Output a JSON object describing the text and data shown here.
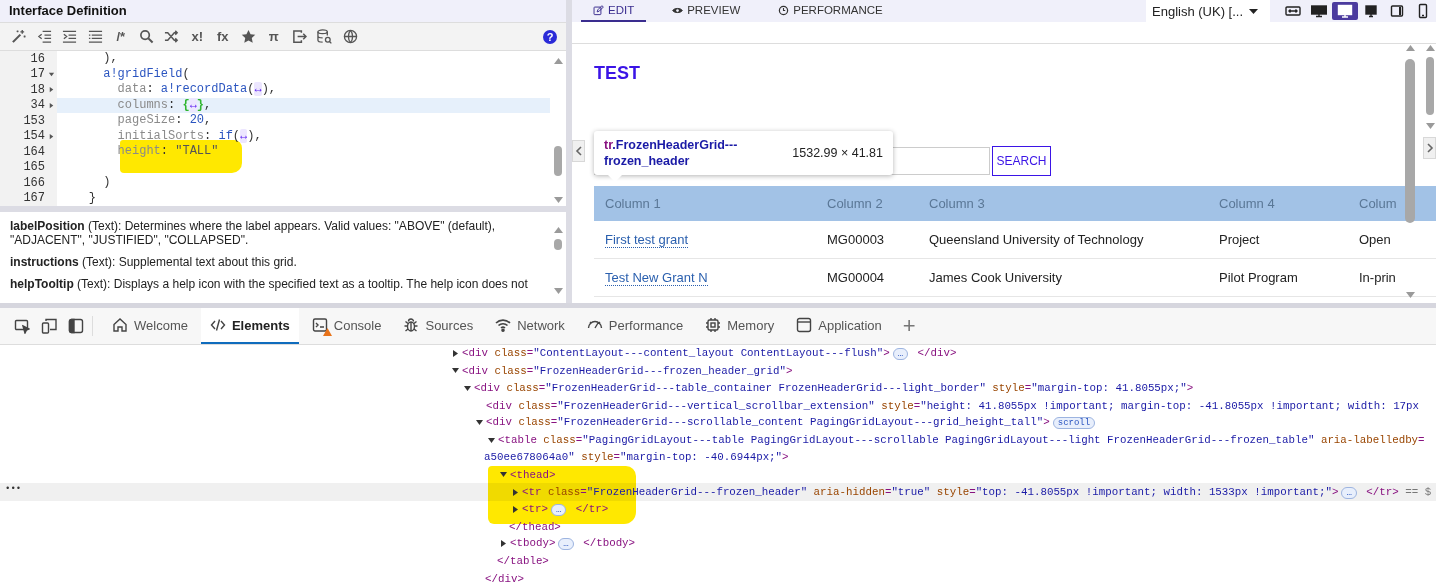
{
  "editor": {
    "title": "Interface Definition",
    "toolbar": [
      {
        "kind": "icon"
      },
      {
        "kind": "icon"
      },
      {
        "kind": "icon"
      },
      {
        "kind": "icon"
      },
      {
        "kind": "glyph",
        "text": "/*"
      },
      {
        "kind": "icon"
      },
      {
        "kind": "icon"
      },
      {
        "kind": "glyph",
        "text": "x!"
      },
      {
        "kind": "glyph",
        "text": "fx"
      },
      {
        "kind": "icon"
      },
      {
        "kind": "glyph",
        "text": "π"
      },
      {
        "kind": "icon"
      },
      {
        "kind": "icon"
      },
      {
        "kind": "icon"
      }
    ],
    "help": "?",
    "lines": [
      {
        "num": "16",
        "current": false,
        "marker": false,
        "tokens": [
          {
            "kind": "p",
            "text": "      ),"
          }
        ]
      },
      {
        "num": "17",
        "expanded": true,
        "current": false,
        "marker": false,
        "tokens": [
          {
            "kind": "fn",
            "text": "      a!gridField"
          },
          {
            "kind": "p",
            "text": "("
          }
        ]
      },
      {
        "num": "18",
        "expanded": false,
        "current": false,
        "marker": false,
        "tokens": [
          {
            "kind": "key",
            "text": "        data"
          },
          {
            "kind": "p",
            "text": ": "
          },
          {
            "kind": "fn",
            "text": "a!recordData"
          },
          {
            "kind": "p",
            "text": "("
          },
          {
            "kind": "fold",
            "text": "↔"
          },
          {
            "kind": "p",
            "text": "),"
          }
        ]
      },
      {
        "num": "34",
        "expanded": false,
        "current": true,
        "marker": false,
        "tokens": [
          {
            "kind": "key",
            "text": "        columns"
          },
          {
            "kind": "p",
            "text": ": "
          },
          {
            "kind": "brace",
            "text": "{"
          },
          {
            "kind": "fold",
            "text": "↔"
          },
          {
            "kind": "brace",
            "text": "}"
          },
          {
            "kind": "p",
            "text": ","
          }
        ]
      },
      {
        "num": "153",
        "current": false,
        "marker": false,
        "tokens": [
          {
            "kind": "key",
            "text": "        pageSize"
          },
          {
            "kind": "p",
            "text": ": "
          },
          {
            "kind": "num",
            "text": "20"
          },
          {
            "kind": "p",
            "text": ","
          }
        ]
      },
      {
        "num": "154",
        "expanded": false,
        "current": false,
        "marker": false,
        "tokens": [
          {
            "kind": "key",
            "text": "        initialSorts"
          },
          {
            "kind": "p",
            "text": ": "
          },
          {
            "kind": "fn",
            "text": "if"
          },
          {
            "kind": "p",
            "text": "("
          },
          {
            "kind": "fold",
            "text": "↔"
          },
          {
            "kind": "p",
            "text": "),"
          }
        ]
      },
      {
        "num": "164",
        "current": false,
        "marker": true,
        "tokens": [
          {
            "kind": "key",
            "text": "        height"
          },
          {
            "kind": "p",
            "text": ": "
          },
          {
            "kind": "str",
            "text": "\"TALL\""
          }
        ]
      },
      {
        "num": "165",
        "current": false,
        "marker": false
      },
      {
        "num": "166",
        "current": false,
        "marker": false,
        "tokens": [
          {
            "kind": "p",
            "text": "      )"
          }
        ]
      },
      {
        "num": "167",
        "current": false,
        "marker": false,
        "tokens": [
          {
            "kind": "p",
            "text": "    }"
          }
        ]
      }
    ],
    "docs": [
      "**labelPosition** (Text): Determines where the label appears. Valid values: \"ABOVE\" (default), \"ADJACENT\", \"JUSTIFIED\", \"COLLAPSED\".",
      "**instructions** (Text): Supplemental text about this grid.",
      "**helpTooltip** (Text): Displays a help icon with the specified text as a tooltip. The help icon does not"
    ]
  },
  "designer": {
    "tabs": [
      {
        "label": "EDIT",
        "selected": true
      },
      {
        "label": "PREVIEW",
        "selected": false
      },
      {
        "label": "PERFORMANCE",
        "selected": false
      }
    ],
    "language": "English (UK) [...",
    "devices": [
      {
        "selected": false
      },
      {
        "selected": false
      },
      {
        "selected": true
      },
      {
        "selected": false
      },
      {
        "selected": false
      },
      {
        "selected": false
      }
    ],
    "title": "TEST",
    "search_button": "SEARCH",
    "tooltip": {
      "tag": "tr",
      "selector": ".FrozenHeaderGrid---frozen_header",
      "size": "1532.99 × 41.81"
    },
    "grid": {
      "columns": [
        {
          "label": "Column 1",
          "kind": "link"
        },
        {
          "label": "Column 2",
          "kind": "text"
        },
        {
          "label": "Column 3",
          "kind": "text"
        },
        {
          "label": "Column 4",
          "kind": "text"
        },
        {
          "label": "Colum",
          "kind": "text"
        }
      ],
      "rows": [
        [
          "First test grant",
          "MG00003",
          "Queensland University of Technology",
          "Project",
          "Open"
        ],
        [
          "Test New Grant N",
          "MG00004",
          "James Cook University",
          "Pilot Program",
          "In-prin"
        ]
      ]
    }
  },
  "devtools": {
    "tabs": [
      {
        "label": "Welcome",
        "selected": false,
        "warning": false
      },
      {
        "label": "Elements",
        "selected": true,
        "warning": false
      },
      {
        "label": "Console",
        "selected": false,
        "warning": true
      },
      {
        "label": "Sources",
        "selected": false,
        "warning": false
      },
      {
        "label": "Network",
        "selected": false,
        "warning": false
      },
      {
        "label": "Performance",
        "selected": false,
        "warning": false
      },
      {
        "label": "Memory",
        "selected": false,
        "warning": false
      },
      {
        "label": "Application",
        "selected": false,
        "warning": false
      }
    ],
    "add": "+",
    "dom": [
      {
        "open": [
          [
            {
              "kind": "tag",
              "text": "<div"
            },
            {
              "kind": "attr",
              "text": " class"
            },
            {
              "kind": "tag",
              "text": "="
            },
            {
              "kind": "val",
              "text": "\"ContentLayout---content_layout ContentLayout---flush\""
            },
            {
              "kind": "tag",
              "text": ">"
            }
          ]
        ],
        "expanded": false,
        "pill": "…",
        "close": "</div>",
        "selected": false
      },
      {
        "open": [
          [
            {
              "kind": "tag",
              "text": "<div"
            },
            {
              "kind": "attr",
              "text": " class"
            },
            {
              "kind": "tag",
              "text": "="
            },
            {
              "kind": "val",
              "text": "\"FrozenHeaderGrid---frozen_header_grid\""
            },
            {
              "kind": "tag",
              "text": ">"
            }
          ]
        ],
        "expanded": true,
        "selected": false,
        "children": [
          {
            "open": [
              [
                {
                  "kind": "tag",
                  "text": "<div"
                },
                {
                  "kind": "attr",
                  "text": " class"
                },
                {
                  "kind": "tag",
                  "text": "="
                },
                {
                  "kind": "val",
                  "text": "\"FrozenHeaderGrid---table_container FrozenHeaderGrid---light_border\""
                },
                {
                  "kind": "attr",
                  "text": " style"
                },
                {
                  "kind": "tag",
                  "text": "="
                },
                {
                  "kind": "val",
                  "text": "\"margin-top: 41.8055px;\""
                },
                {
                  "kind": "tag",
                  "text": ">"
                }
              ]
            ],
            "expanded": true,
            "selected": false,
            "children": [
              {
                "open": [
                  [
                    {
                      "kind": "tag",
                      "text": "<div"
                    },
                    {
                      "kind": "attr",
                      "text": " class"
                    },
                    {
                      "kind": "tag",
                      "text": "="
                    },
                    {
                      "kind": "val",
                      "text": "\"FrozenHeaderGrid---vertical_scrollbar_extension\""
                    },
                    {
                      "kind": "attr",
                      "text": " style"
                    },
                    {
                      "kind": "tag",
                      "text": "="
                    },
                    {
                      "kind": "val",
                      "text": "\"height: 41.8055px !important; margin-top: -41.8055px !important; width: 17px"
                    }
                  ]
                ],
                "selected": false
              },
              {
                "open": [
                  [
                    {
                      "kind": "tag",
                      "text": "<div"
                    },
                    {
                      "kind": "attr",
                      "text": " class"
                    },
                    {
                      "kind": "tag",
                      "text": "="
                    },
                    {
                      "kind": "val",
                      "text": "\"FrozenHeaderGrid---scrollable_content PagingGridLayout---grid_height_tall\""
                    },
                    {
                      "kind": "tag",
                      "text": ">"
                    },
                    {
                      "kind": "pill",
                      "text": "scroll"
                    }
                  ]
                ],
                "expanded": true,
                "selected": false,
                "close": "</div>",
                "children": [
                  {
                    "open": [
                      [
                        {
                          "kind": "tag",
                          "text": "<table"
                        },
                        {
                          "kind": "attr",
                          "text": " class"
                        },
                        {
                          "kind": "tag",
                          "text": "="
                        },
                        {
                          "kind": "val",
                          "text": "\"PagingGridLayout---table PagingGridLayout---scrollable PagingGridLayout---light FrozenHeaderGrid---frozen_table\""
                        },
                        {
                          "kind": "attr",
                          "text": " aria-labelledby"
                        },
                        {
                          "kind": "tag",
                          "text": "="
                        }
                      ],
                      [
                        {
                          "kind": "val",
                          "text": "a50ee678064a0\""
                        },
                        {
                          "kind": "attr",
                          "text": " style"
                        },
                        {
                          "kind": "tag",
                          "text": "="
                        },
                        {
                          "kind": "val",
                          "text": "\"margin-top: -40.6944px;\""
                        },
                        {
                          "kind": "tag",
                          "text": ">"
                        }
                      ]
                    ],
                    "expanded": true,
                    "selected": false,
                    "close": "</table>",
                    "children": [
                      {
                        "open": [
                          [
                            {
                              "kind": "tag",
                              "text": "<thead>"
                            }
                          ]
                        ],
                        "expanded": true,
                        "selected": false,
                        "marker": true,
                        "close": "</thead>",
                        "children": [
                          {
                            "open": [
                              [
                                {
                                  "kind": "tag",
                                  "text": "<tr"
                                },
                                {
                                  "kind": "attr",
                                  "text": " class"
                                },
                                {
                                  "kind": "tag",
                                  "text": "="
                                },
                                {
                                  "kind": "val",
                                  "text": "\"FrozenHeaderGrid---frozen_header\""
                                },
                                {
                                  "kind": "attr",
                                  "text": " aria-hidden"
                                },
                                {
                                  "kind": "tag",
                                  "text": "="
                                },
                                {
                                  "kind": "val",
                                  "text": "\"true\""
                                },
                                {
                                  "kind": "attr",
                                  "text": " style"
                                },
                                {
                                  "kind": "tag",
                                  "text": "="
                                },
                                {
                                  "kind": "val",
                                  "text": "\"top: -41.8055px !important; width: 1533px !important;\""
                                },
                                {
                                  "kind": "tag",
                                  "text": ">"
                                }
                              ]
                            ],
                            "expanded": false,
                            "pill": "…",
                            "close": "</tr>",
                            "selected": true,
                            "after": "== $",
                            "gutter": "•••"
                          },
                          {
                            "open": [
                              [
                                {
                                  "kind": "tag",
                                  "text": "<tr>"
                                }
                              ]
                            ],
                            "expanded": false,
                            "pill": "…",
                            "close": "</tr>",
                            "selected": false
                          }
                        ]
                      },
                      {
                        "open": [
                          [
                            {
                              "kind": "tag",
                              "text": "<tbody>"
                            }
                          ]
                        ],
                        "expanded": false,
                        "pill": "…",
                        "close": "</tbody>",
                        "selected": false
                      }
                    ]
                  }
                ]
              }
            ]
          }
        ]
      }
    ]
  }
}
